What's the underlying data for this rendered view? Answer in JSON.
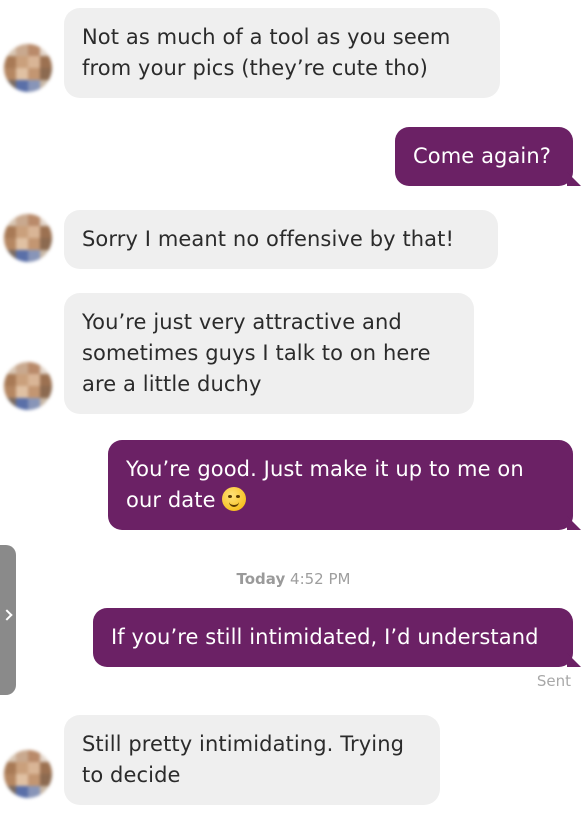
{
  "conversation": {
    "messages": [
      {
        "direction": "incoming",
        "text": "Not as much of a tool as you seem from your pics (they’re cute tho)"
      },
      {
        "direction": "outgoing",
        "text": "Come again?"
      },
      {
        "direction": "incoming",
        "text": "Sorry I meant no offensive by that!"
      },
      {
        "direction": "incoming",
        "text": "You’re just very attractive and sometimes guys I talk to on here are a little duchy"
      },
      {
        "direction": "outgoing",
        "text": "You’re good. Just make it up to me on our date",
        "emoji": "winking-face"
      },
      {
        "direction": "outgoing",
        "text": "If you’re still intimidated, I’d understand"
      },
      {
        "direction": "incoming",
        "text": "Still pretty intimidating. Trying to decide"
      }
    ],
    "timestamp": {
      "day": "Today",
      "time": "4:52 PM"
    },
    "status": "Sent"
  },
  "colors": {
    "outgoing_bubble": "#6b2165",
    "incoming_bubble": "#efefef",
    "meta_text": "#9e9e9e"
  }
}
